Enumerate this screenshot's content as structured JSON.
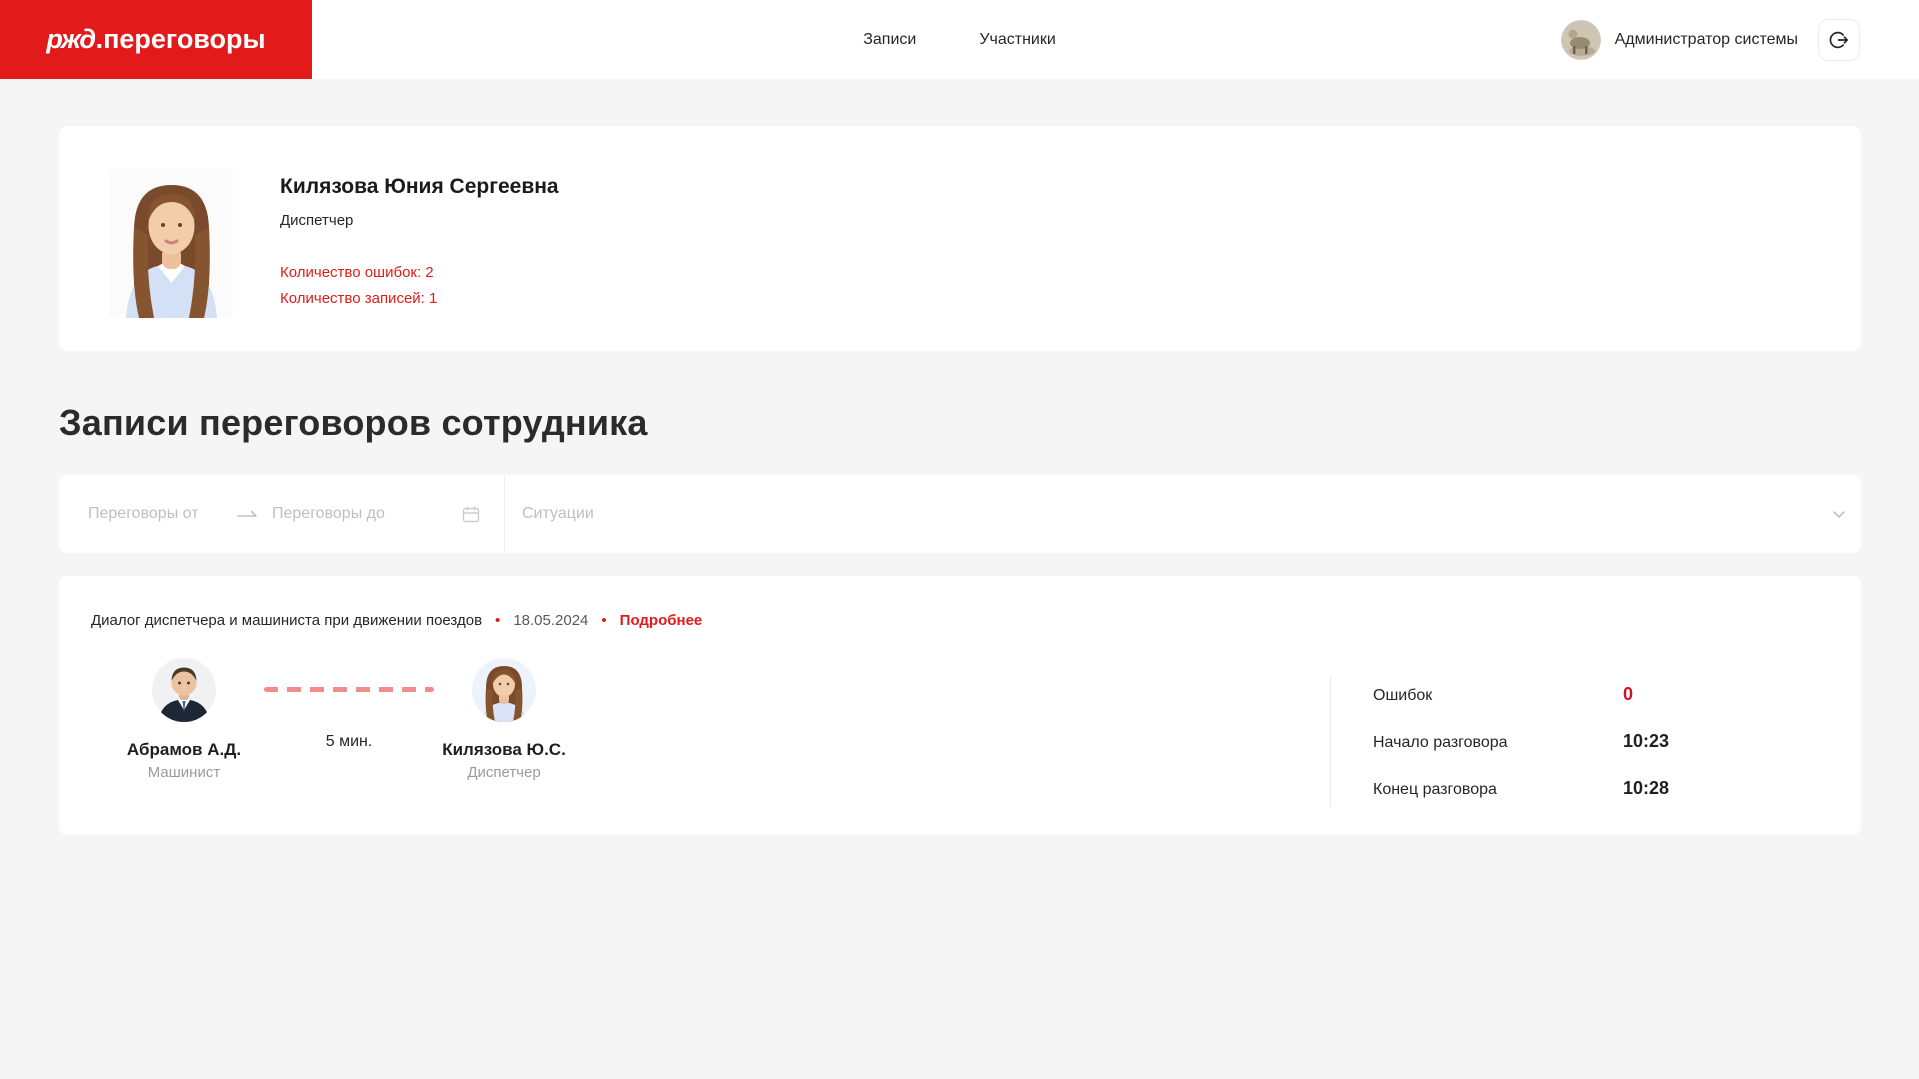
{
  "header": {
    "logo_brand": "ржд",
    "logo_suffix": ".переговоры",
    "nav_records": "Записи",
    "nav_participants": "Участники",
    "user_name": "Администратор системы"
  },
  "profile": {
    "name": "Килязова Юния Сергеевна",
    "role": "Диспетчер",
    "errors_label": "Количество ошибок: 2",
    "records_label": "Количество записей: 1"
  },
  "section_title": "Записи переговоров сотрудника",
  "filters": {
    "date_from_placeholder": "Переговоры от",
    "date_to_placeholder": "Переговоры до",
    "situations_placeholder": "Ситуации"
  },
  "record": {
    "title": "Диалог диспетчера и машиниста при движении поездов",
    "bullet": "•",
    "date": "18.05.2024",
    "details_label": "Подробнее",
    "duration": "5 мин.",
    "left": {
      "name": "Абрамов А.Д.",
      "role": "Машинист"
    },
    "right": {
      "name": "Килязова Ю.С.",
      "role": "Диспетчер"
    },
    "stats": [
      {
        "label": "Ошибок",
        "value": "0"
      },
      {
        "label": "Начало разговора",
        "value": "10:23"
      },
      {
        "label": "Конец разговора",
        "value": "10:28"
      }
    ]
  },
  "icons": [
    "logout-icon",
    "calendar-icon",
    "swap-right-icon",
    "chevron-down-icon",
    "user-avatar-image"
  ],
  "colors": {
    "brand_red": "#e21a1a",
    "value_red": "#cf1322",
    "dash_pink": "#f08c8c",
    "page_bg": "#f5f5f5",
    "card_bg": "#ffffff"
  }
}
